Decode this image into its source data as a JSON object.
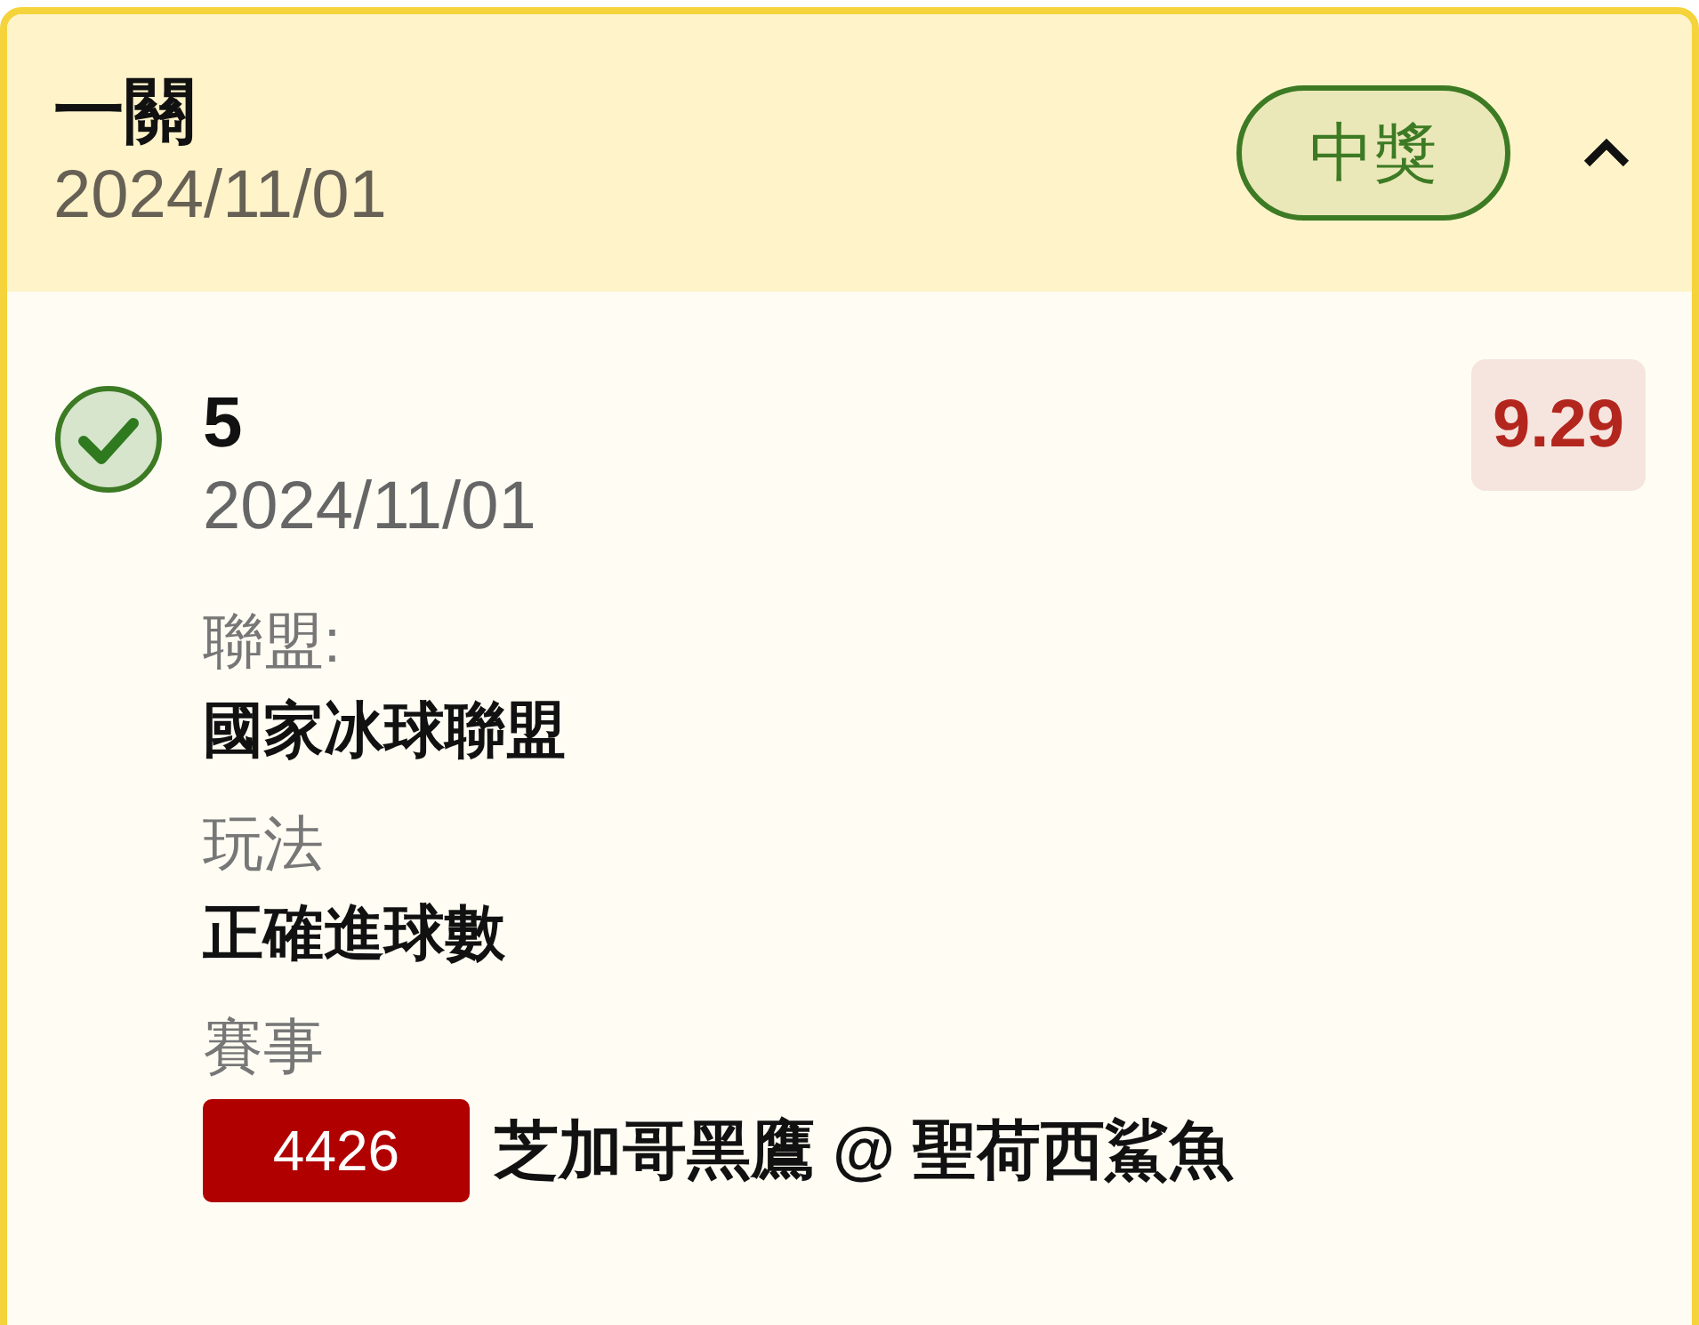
{
  "header": {
    "title": "一關",
    "date": "2024/11/01",
    "result_badge": "中獎",
    "expanded": true
  },
  "selection": {
    "checked": true,
    "title": "5",
    "date": "2024/11/01",
    "odds": "9.29"
  },
  "details": [
    {
      "label": "聯盟:",
      "value": "國家冰球聯盟"
    },
    {
      "label": "玩法",
      "value": "正確進球數"
    }
  ],
  "match": {
    "label": "賽事",
    "number": "4426",
    "name": "芝加哥黑鷹 @ 聖荷西鯊魚"
  }
}
